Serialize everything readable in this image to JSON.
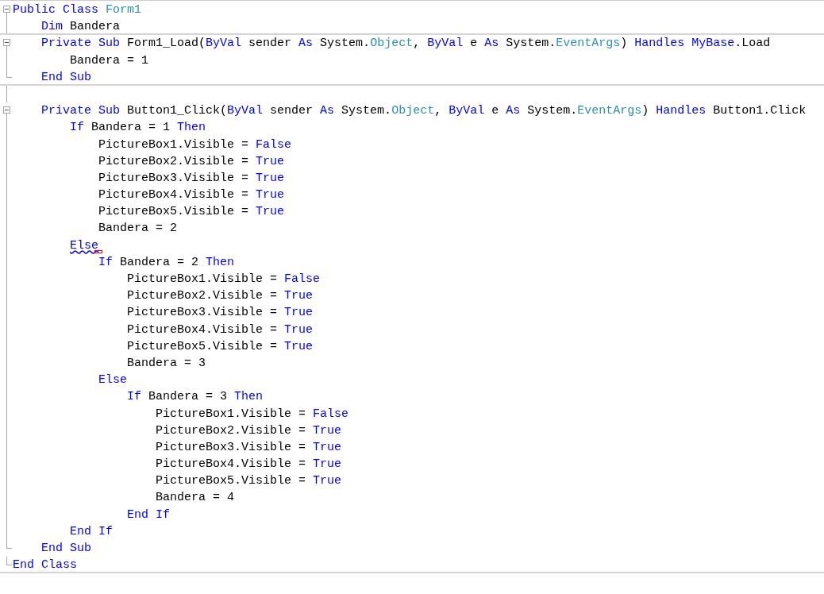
{
  "editor": {
    "lines": [
      {
        "collapsible": true,
        "separator": false,
        "tokens": [
          {
            "text": "Public Class ",
            "kind": "keyword"
          },
          {
            "text": "Form1",
            "kind": "type"
          }
        ],
        "children": [
          {
            "collapsible": false,
            "separator": true,
            "tokens": [
              {
                "text": "Dim",
                "kind": "keyword"
              },
              {
                "text": " Bandera",
                "kind": "plain"
              }
            ]
          },
          {
            "collapsible": true,
            "separator": false,
            "tokens": [
              {
                "text": "Private Sub",
                "kind": "keyword"
              },
              {
                "text": " Form1_Load(",
                "kind": "plain"
              },
              {
                "text": "ByVal",
                "kind": "keyword"
              },
              {
                "text": " sender ",
                "kind": "plain"
              },
              {
                "text": "As",
                "kind": "keyword"
              },
              {
                "text": " System.",
                "kind": "plain"
              },
              {
                "text": "Object",
                "kind": "type"
              },
              {
                "text": ", ",
                "kind": "plain"
              },
              {
                "text": "ByVal",
                "kind": "keyword"
              },
              {
                "text": " e ",
                "kind": "plain"
              },
              {
                "text": "As",
                "kind": "keyword"
              },
              {
                "text": " System.",
                "kind": "plain"
              },
              {
                "text": "EventArgs",
                "kind": "type"
              },
              {
                "text": ") ",
                "kind": "plain"
              },
              {
                "text": "Handles MyBase",
                "kind": "keyword"
              },
              {
                "text": ".Load",
                "kind": "plain"
              }
            ],
            "children": [
              {
                "collapsible": false,
                "separator": false,
                "tokens": [
                  {
                    "text": "Bandera = 1",
                    "kind": "plain"
                  }
                ]
              }
            ]
          },
          {
            "collapsible": false,
            "separator": true,
            "tokens": [
              {
                "text": "End Sub",
                "kind": "keyword"
              }
            ]
          },
          {
            "collapsible": false,
            "separator": false
          },
          {
            "collapsible": true,
            "separator": false,
            "tokens": [
              {
                "text": "Private Sub",
                "kind": "keyword"
              },
              {
                "text": " Button1_Click(",
                "kind": "plain"
              },
              {
                "text": "ByVal",
                "kind": "keyword"
              },
              {
                "text": " sender ",
                "kind": "plain"
              },
              {
                "text": "As",
                "kind": "keyword"
              },
              {
                "text": " System.",
                "kind": "plain"
              },
              {
                "text": "Object",
                "kind": "type"
              },
              {
                "text": ", ",
                "kind": "plain"
              },
              {
                "text": "ByVal",
                "kind": "keyword"
              },
              {
                "text": " e ",
                "kind": "plain"
              },
              {
                "text": "As",
                "kind": "keyword"
              },
              {
                "text": " System.",
                "kind": "plain"
              },
              {
                "text": "EventArgs",
                "kind": "type"
              },
              {
                "text": ") ",
                "kind": "plain"
              },
              {
                "text": "Handles",
                "kind": "keyword"
              },
              {
                "text": " Button1.Click",
                "kind": "plain"
              }
            ],
            "children": [
              {
                "collapsible": false,
                "separator": false,
                "tokens": [
                  {
                    "text": "If",
                    "kind": "keyword"
                  },
                  {
                    "text": " Bandera = 1 ",
                    "kind": "plain"
                  },
                  {
                    "text": "Then",
                    "kind": "keyword"
                  }
                ],
                "children": [
                  {
                    "collapsible": false,
                    "separator": false,
                    "tokens": [
                      {
                        "text": "PictureBox1.Visible = ",
                        "kind": "plain"
                      },
                      {
                        "text": "False",
                        "kind": "keyword"
                      }
                    ]
                  },
                  {
                    "collapsible": false,
                    "separator": false,
                    "tokens": [
                      {
                        "text": "PictureBox2.Visible = ",
                        "kind": "plain"
                      },
                      {
                        "text": "True",
                        "kind": "keyword"
                      }
                    ]
                  },
                  {
                    "collapsible": false,
                    "separator": false,
                    "tokens": [
                      {
                        "text": "PictureBox3.Visible = ",
                        "kind": "plain"
                      },
                      {
                        "text": "True",
                        "kind": "keyword"
                      }
                    ]
                  },
                  {
                    "collapsible": false,
                    "separator": false,
                    "tokens": [
                      {
                        "text": "PictureBox4.Visible = ",
                        "kind": "plain"
                      },
                      {
                        "text": "True",
                        "kind": "keyword"
                      }
                    ]
                  },
                  {
                    "collapsible": false,
                    "separator": false,
                    "tokens": [
                      {
                        "text": "PictureBox5.Visible = ",
                        "kind": "plain"
                      },
                      {
                        "text": "True",
                        "kind": "keyword"
                      }
                    ]
                  },
                  {
                    "collapsible": false,
                    "separator": false,
                    "tokens": [
                      {
                        "text": "Bandera = 2",
                        "kind": "plain"
                      }
                    ]
                  }
                ]
              },
              {
                "collapsible": false,
                "separator": false,
                "tokens": [
                  {
                    "text": "Else",
                    "kind": "keyword",
                    "error": true
                  }
                ],
                "children": [
                  {
                    "collapsible": false,
                    "separator": false,
                    "tokens": [
                      {
                        "text": "If",
                        "kind": "keyword"
                      },
                      {
                        "text": " Bandera = 2 ",
                        "kind": "plain"
                      },
                      {
                        "text": "Then",
                        "kind": "keyword"
                      }
                    ],
                    "children": [
                      {
                        "collapsible": false,
                        "separator": false,
                        "tokens": [
                          {
                            "text": "PictureBox1.Visible = ",
                            "kind": "plain"
                          },
                          {
                            "text": "False",
                            "kind": "keyword"
                          }
                        ]
                      },
                      {
                        "collapsible": false,
                        "separator": false,
                        "tokens": [
                          {
                            "text": "PictureBox2.Visible = ",
                            "kind": "plain"
                          },
                          {
                            "text": "True",
                            "kind": "keyword"
                          }
                        ]
                      },
                      {
                        "collapsible": false,
                        "separator": false,
                        "tokens": [
                          {
                            "text": "PictureBox3.Visible = ",
                            "kind": "plain"
                          },
                          {
                            "text": "True",
                            "kind": "keyword"
                          }
                        ]
                      },
                      {
                        "collapsible": false,
                        "separator": false,
                        "tokens": [
                          {
                            "text": "PictureBox4.Visible = ",
                            "kind": "plain"
                          },
                          {
                            "text": "True",
                            "kind": "keyword"
                          }
                        ]
                      },
                      {
                        "collapsible": false,
                        "separator": false,
                        "tokens": [
                          {
                            "text": "PictureBox5.Visible = ",
                            "kind": "plain"
                          },
                          {
                            "text": "True",
                            "kind": "keyword"
                          }
                        ]
                      },
                      {
                        "collapsible": false,
                        "separator": false,
                        "tokens": [
                          {
                            "text": "Bandera = 3",
                            "kind": "plain"
                          }
                        ]
                      }
                    ]
                  },
                  {
                    "collapsible": false,
                    "separator": false,
                    "tokens": [
                      {
                        "text": "Else",
                        "kind": "keyword"
                      }
                    ],
                    "children": [
                      {
                        "collapsible": false,
                        "separator": false,
                        "tokens": [
                          {
                            "text": "If",
                            "kind": "keyword"
                          },
                          {
                            "text": " Bandera = 3 ",
                            "kind": "plain"
                          },
                          {
                            "text": "Then",
                            "kind": "keyword"
                          }
                        ],
                        "children": [
                          {
                            "collapsible": false,
                            "separator": false,
                            "tokens": [
                              {
                                "text": "PictureBox1.Visible = ",
                                "kind": "plain"
                              },
                              {
                                "text": "False",
                                "kind": "keyword"
                              }
                            ]
                          },
                          {
                            "collapsible": false,
                            "separator": false,
                            "tokens": [
                              {
                                "text": "PictureBox2.Visible = ",
                                "kind": "plain"
                              },
                              {
                                "text": "True",
                                "kind": "keyword"
                              }
                            ]
                          },
                          {
                            "collapsible": false,
                            "separator": false,
                            "tokens": [
                              {
                                "text": "PictureBox3.Visible = ",
                                "kind": "plain"
                              },
                              {
                                "text": "True",
                                "kind": "keyword"
                              }
                            ]
                          },
                          {
                            "collapsible": false,
                            "separator": false,
                            "tokens": [
                              {
                                "text": "PictureBox4.Visible = ",
                                "kind": "plain"
                              },
                              {
                                "text": "True",
                                "kind": "keyword"
                              }
                            ]
                          },
                          {
                            "collapsible": false,
                            "separator": false,
                            "tokens": [
                              {
                                "text": "PictureBox5.Visible = ",
                                "kind": "plain"
                              },
                              {
                                "text": "True",
                                "kind": "keyword"
                              }
                            ]
                          },
                          {
                            "collapsible": false,
                            "separator": false,
                            "tokens": [
                              {
                                "text": "Bandera = 4",
                                "kind": "plain"
                              }
                            ]
                          }
                        ]
                      },
                      {
                        "collapsible": false,
                        "separator": false,
                        "tokens": [
                          {
                            "text": "End If",
                            "kind": "keyword"
                          }
                        ]
                      }
                    ]
                  }
                ]
              },
              {
                "collapsible": false,
                "separator": false,
                "tokens": [
                  {
                    "text": "End If",
                    "kind": "keyword"
                  }
                ]
              }
            ]
          },
          {
            "collapsible": false,
            "separator": false,
            "tokens": [
              {
                "text": "End Sub",
                "kind": "keyword"
              }
            ]
          }
        ]
      },
      {
        "collapsible": false,
        "separator": true,
        "tokens": [
          {
            "text": "End Class",
            "kind": "keyword"
          }
        ]
      }
    ]
  }
}
